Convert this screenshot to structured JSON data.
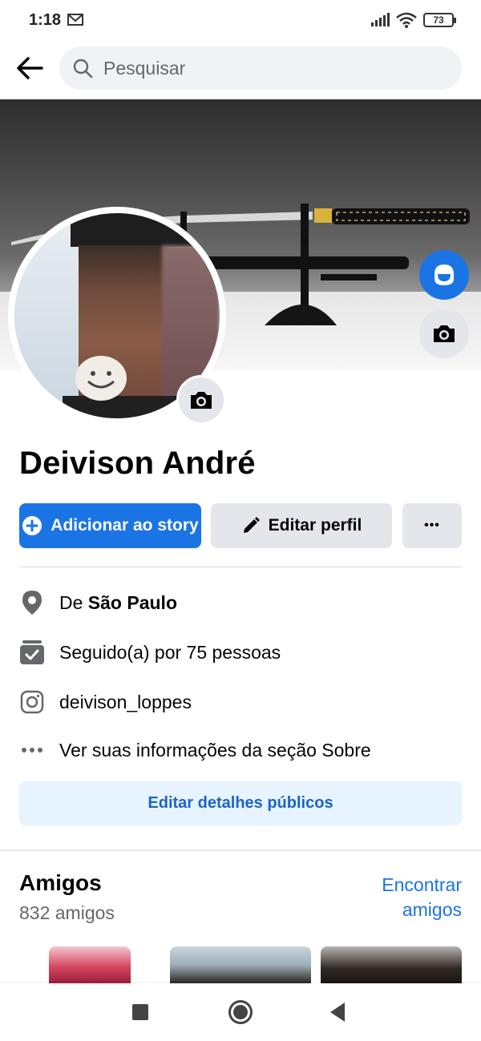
{
  "status_bar": {
    "time": "1:18",
    "battery": "73",
    "icons": [
      "mail-icon",
      "signal-icon",
      "wifi-icon",
      "battery-icon"
    ]
  },
  "search": {
    "placeholder": "Pesquisar"
  },
  "profile": {
    "name": "Deivison André"
  },
  "actions": {
    "add_story": "Adicionar ao story",
    "edit_profile": "Editar perfil",
    "more": "•••"
  },
  "info": {
    "location_prefix": "De ",
    "location_city": "São Paulo",
    "followers": "Seguido(a) por 75 pessoas",
    "instagram": "deivison_loppes",
    "about": "Ver suas informações da seção Sobre"
  },
  "edit_details": "Editar detalhes públicos",
  "friends": {
    "title": "Amigos",
    "count": "832 amigos",
    "find": "Encontrar amigos"
  },
  "colors": {
    "primary": "#1b74e4",
    "link": "#1b64c8",
    "light_blue_bg": "#e7f3ff",
    "gray_button": "#e4e6eb",
    "secondary_text": "#65676b"
  }
}
